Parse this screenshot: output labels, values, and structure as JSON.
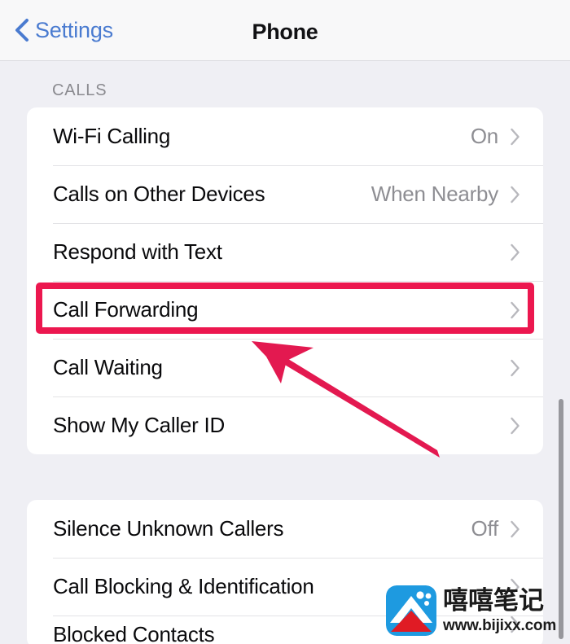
{
  "navbar": {
    "back_label": "Settings",
    "back_icon": "chevron-left-icon",
    "title": "Phone",
    "back_color": "#4a7bd0"
  },
  "sections": [
    {
      "header": "CALLS",
      "rows": [
        {
          "label": "Wi-Fi Calling",
          "value": "On",
          "chevron": "chevron-right-icon"
        },
        {
          "label": "Calls on Other Devices",
          "value": "When Nearby",
          "chevron": "chevron-right-icon"
        },
        {
          "label": "Respond with Text",
          "value": "",
          "chevron": "chevron-right-icon"
        },
        {
          "label": "Call Forwarding",
          "value": "",
          "chevron": "chevron-right-icon",
          "highlighted": true
        },
        {
          "label": "Call Waiting",
          "value": "",
          "chevron": "chevron-right-icon"
        },
        {
          "label": "Show My Caller ID",
          "value": "",
          "chevron": "chevron-right-icon"
        }
      ]
    },
    {
      "header": "",
      "rows": [
        {
          "label": "Silence Unknown Callers",
          "value": "Off",
          "chevron": "chevron-right-icon"
        },
        {
          "label": "Call Blocking & Identification",
          "value": "",
          "chevron": "chevron-right-icon"
        },
        {
          "label": "Blocked Contacts",
          "value": "",
          "chevron": "chevron-right-icon",
          "clipped": true
        }
      ]
    }
  ],
  "annotation": {
    "highlight_color": "#ec174f",
    "arrow_color": "#e31950",
    "target_row_label": "Call Forwarding"
  },
  "scrollbar": {
    "color": "#97979c"
  },
  "watermark": {
    "title": "嘻嘻笔记",
    "url": "www.bijixx.com",
    "logo_blue": "#1e9ae0",
    "logo_red": "#e01b24"
  }
}
